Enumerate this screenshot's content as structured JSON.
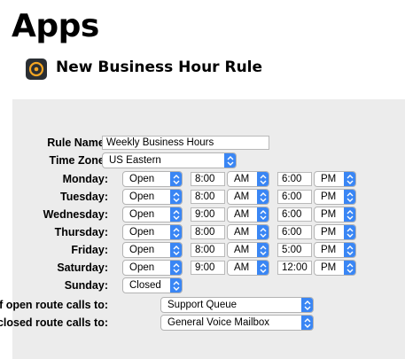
{
  "page_title": "Apps",
  "rule_title": "New Business Hour Rule",
  "form": {
    "rule_name_label": "Rule Name:",
    "rule_name_value": "Weekly Business Hours",
    "time_zone_label": "Time Zone:",
    "time_zone_value": "US Eastern",
    "days": [
      {
        "label": "Monday:",
        "status": "Open",
        "start": "8:00",
        "start_ampm": "AM",
        "end": "6:00",
        "end_ampm": "PM"
      },
      {
        "label": "Tuesday:",
        "status": "Open",
        "start": "8:00",
        "start_ampm": "AM",
        "end": "6:00",
        "end_ampm": "PM"
      },
      {
        "label": "Wednesday:",
        "status": "Open",
        "start": "9:00",
        "start_ampm": "AM",
        "end": "6:00",
        "end_ampm": "PM"
      },
      {
        "label": "Thursday:",
        "status": "Open",
        "start": "8:00",
        "start_ampm": "AM",
        "end": "6:00",
        "end_ampm": "PM"
      },
      {
        "label": "Friday:",
        "status": "Open",
        "start": "8:00",
        "start_ampm": "AM",
        "end": "5:00",
        "end_ampm": "PM"
      },
      {
        "label": "Saturday:",
        "status": "Open",
        "start": "9:00",
        "start_ampm": "AM",
        "end": "12:00",
        "end_ampm": "PM"
      },
      {
        "label": "Sunday:",
        "status": "Closed"
      }
    ],
    "open_route_label": "If open route calls to:",
    "open_route_value": "Support Queue",
    "closed_route_label": "If closed route calls to:",
    "closed_route_value": "General Voice Mailbox"
  },
  "colors": {
    "stepper_blue": "#3a86f4",
    "panel_gray": "#ececec",
    "app_icon_dark": "#2b2f33",
    "app_icon_accent": "#f5a623"
  },
  "icons": {
    "app_icon": "app-record-icon",
    "stepper": "chevron-up-down-icon"
  }
}
